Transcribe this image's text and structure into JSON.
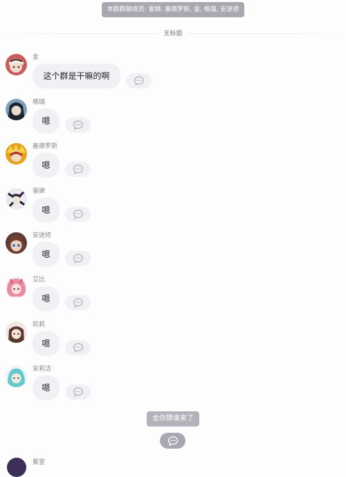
{
  "header": {
    "members_banner": "本群群聊成员: 雷狮, 嘉德罗斯, 金, 格瑞, 安迷修",
    "chat_title": "无标题"
  },
  "messages": [
    {
      "sender": "金",
      "text": "这个群是干嘛的啊"
    },
    {
      "sender": "格瑞",
      "text": "嗯"
    },
    {
      "sender": "嘉德罗斯",
      "text": "嗯"
    },
    {
      "sender": "雷狮",
      "text": "嗯"
    },
    {
      "sender": "安迷修",
      "text": "嗯"
    },
    {
      "sender": "艾比",
      "text": "嗯"
    },
    {
      "sender": "凯莉",
      "text": "嗯"
    },
    {
      "sender": "安莉洁",
      "text": "嗯"
    }
  ],
  "system_note": "金你猜谁来了",
  "partial": {
    "sender": "紫堂"
  },
  "icons": {
    "reply": "chat-bubble-icon",
    "avatar": "avatar-image"
  },
  "colors": {
    "banner_bg": "#a8a8b0",
    "bubble_bg": "#f0f0f5",
    "system_note_bg": "#b2b2ba"
  }
}
